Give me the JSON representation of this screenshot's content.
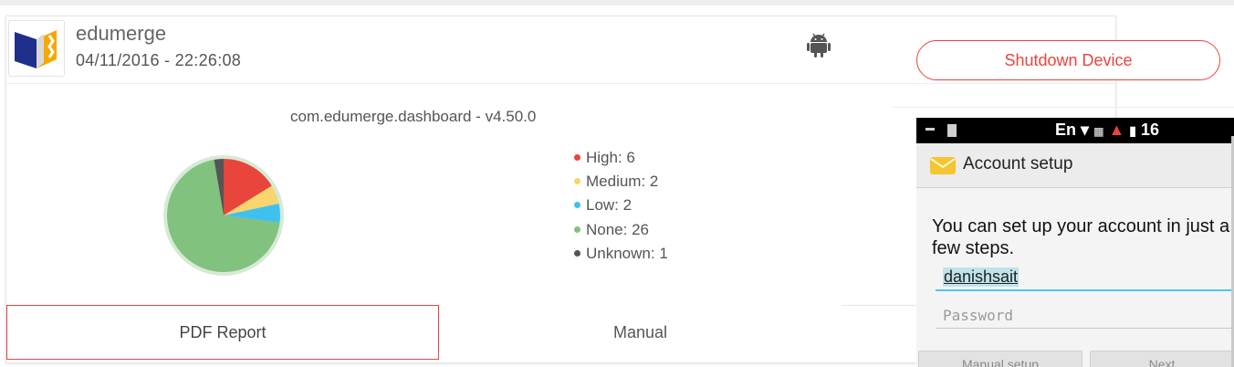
{
  "app": {
    "name": "edumerge",
    "date": "04/11/2016 - 22:26:08",
    "logo_icon": "edumerge-book-logo",
    "platform_icon": "android-icon",
    "package": "com.edumerge.dashboard - v4.50.0"
  },
  "chart_data": {
    "type": "pie",
    "slices": [
      {
        "label": "High",
        "value": 6,
        "color": "#e8453c"
      },
      {
        "label": "Medium",
        "value": 2,
        "color": "#f9d56e"
      },
      {
        "label": "Low",
        "value": 2,
        "color": "#3fc1f0"
      },
      {
        "label": "None",
        "value": 26,
        "color": "#80c27e"
      },
      {
        "label": "Unknown",
        "value": 1,
        "color": "#555555"
      }
    ],
    "legend_text": [
      "High: 6",
      "Medium: 2",
      "Low: 2",
      "None: 26",
      "Unknown: 1"
    ],
    "legend_placement": "right"
  },
  "buttons": {
    "pdf_report": "PDF Report",
    "manual": "Manual",
    "shutdown": "Shutdown Device"
  },
  "phone": {
    "status_right": "En",
    "status_tail": "16",
    "appbar_title": "Account setup",
    "intro_text": "You can set up your account in just a few steps.",
    "username_value": "danishsait",
    "password_placeholder": "Password",
    "button_manual": "Manual setup",
    "button_next": "Next"
  },
  "colors": {
    "accent": "#e8453c",
    "high": "#e8453c",
    "medium": "#f9d56e",
    "low": "#3fc1f0",
    "none": "#80c27e",
    "unknown": "#555555"
  }
}
